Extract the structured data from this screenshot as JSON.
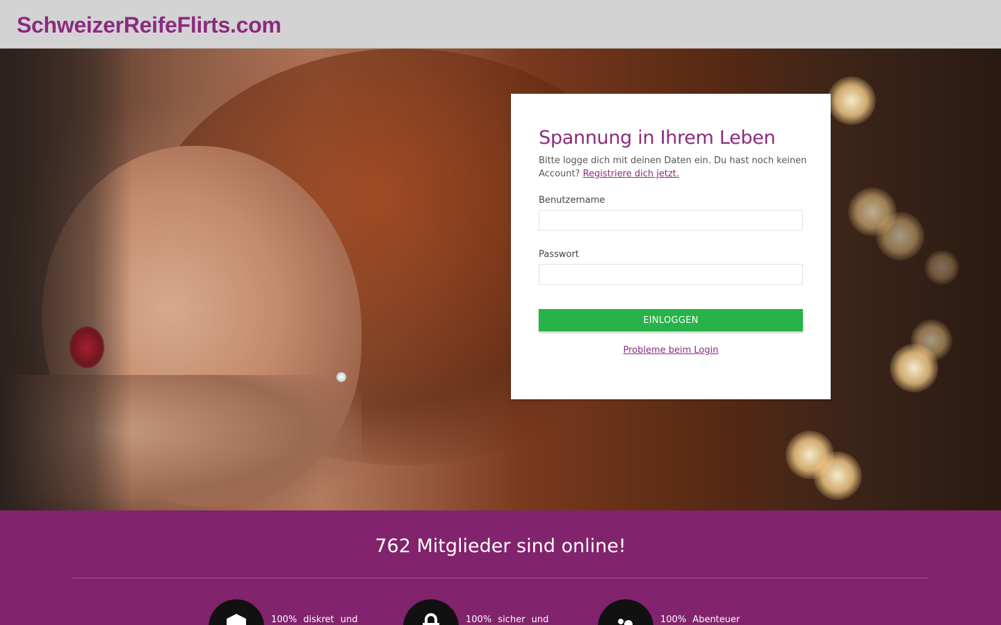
{
  "header": {
    "logo_text": "SchweizerReifeFlirts.com"
  },
  "login": {
    "title": "Spannung in Ihrem Leben",
    "intro_text": "Bitte logge dich mit deinen Daten ein. Du hast noch keinen Account?",
    "register_link": "Registriere dich jetzt.",
    "username_label": "Benutzername",
    "username_value": "",
    "password_label": "Passwort",
    "password_value": "",
    "submit_label": "EINLOGGEN",
    "problem_link": "Probleme beim Login"
  },
  "stats": {
    "online_text": "762 Mitglieder sind online!"
  },
  "features": [
    {
      "icon": "shield-icon",
      "text": "100% diskret und"
    },
    {
      "icon": "lock-icon",
      "text": "100% sicher und"
    },
    {
      "icon": "people-icon",
      "text": "100% Abenteuer"
    }
  ],
  "colors": {
    "brand": "#8a2b7e",
    "band": "#82236d",
    "button": "#27b24a",
    "header": "#d3d3d3"
  }
}
